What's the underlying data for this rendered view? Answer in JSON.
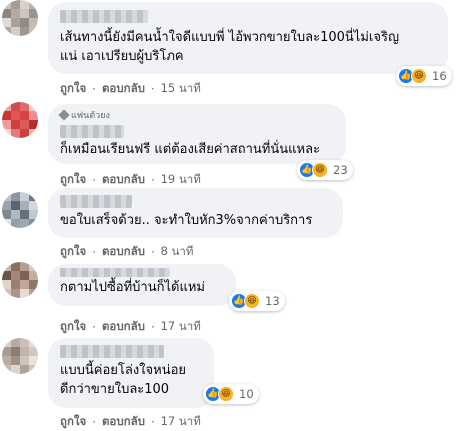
{
  "reactions": {
    "like_icon": "like-icon",
    "haha_icon": "haha-icon",
    "like_glyph": "👍",
    "haha_glyph": "😆"
  },
  "comments": [
    {
      "lines": [
        "เส้นทางนี้ยังมีคนน้ำใจดีแบบพี่ ไอ้พวกขายใบละ100นี่ไม่เจริญ",
        "แน่ เอาเปรียบผู้บริโภค"
      ],
      "like": "ถูกใจ",
      "reply": "ตอบกลับ",
      "time": "15 นาที",
      "count": "16"
    },
    {
      "badge": "แฟนตัวยง",
      "lines": [
        "ก็เหมือนเรียนฟรี แต่ต้องเสียค่าสถานที่นั่นแหละ"
      ],
      "like": "ถูกใจ",
      "reply": "ตอบกลับ",
      "time": "19 นาที",
      "count": "23"
    },
    {
      "lines": [
        "ขอใบเสร็จด้วย.. จะทำใบหัก3%จากค่าบริการ"
      ],
      "like": "ถูกใจ",
      "reply": "ตอบกลับ",
      "time": "8 นาที"
    },
    {
      "lines": [
        "กตามไปซื้อที่บ้านก็ได้แหม่"
      ],
      "like": "ถูกใจ",
      "reply": "ตอบกลับ",
      "time": "17 นาที",
      "count": "13"
    },
    {
      "lines": [
        "แบบนี้ค่อยโล่งใจหน่อย",
        "ดีกว่าขายใบละ100"
      ],
      "like": "ถูกใจ",
      "reply": "ตอบกลับ",
      "time": "17 นาที",
      "count": "10"
    }
  ],
  "separator": "·"
}
